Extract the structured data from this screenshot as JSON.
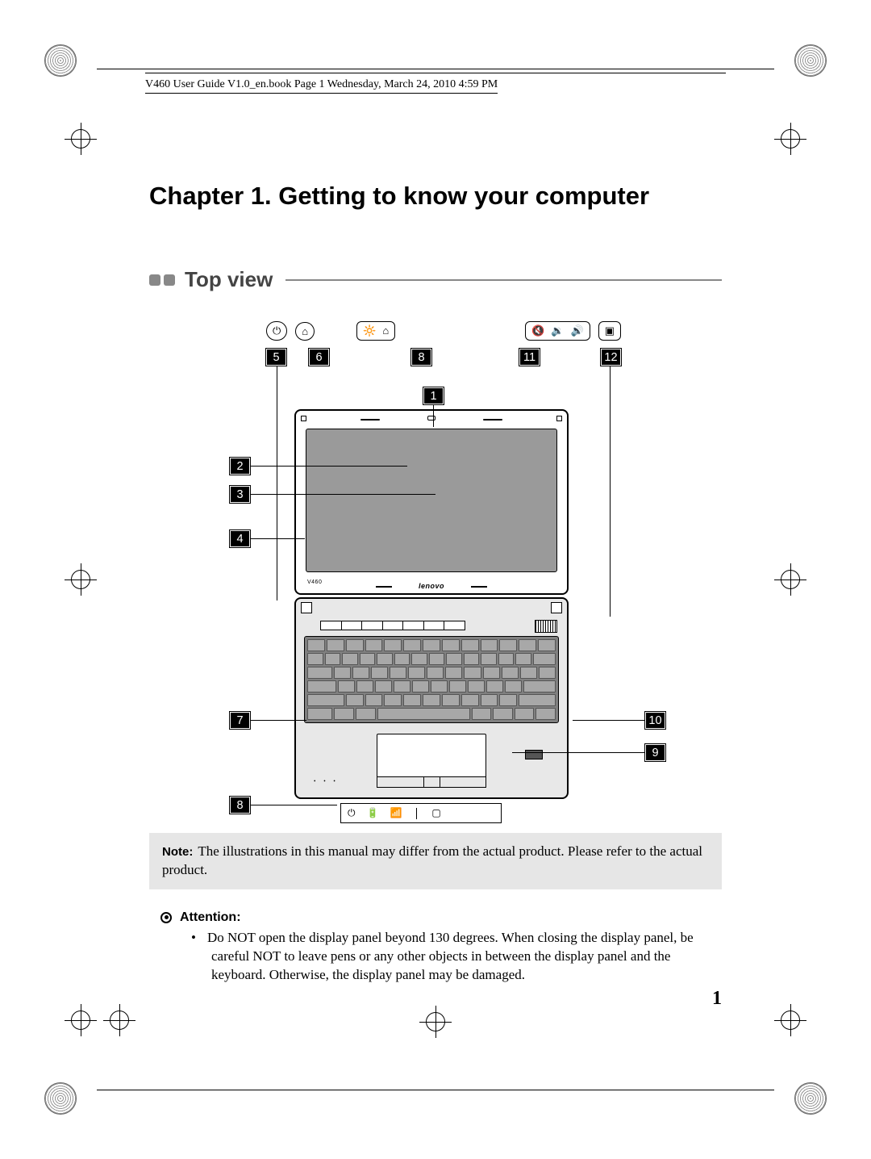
{
  "header": {
    "running_head": "V460 User Guide V1.0_en.book  Page 1  Wednesday, March 24, 2010  4:59 PM"
  },
  "chapter": {
    "title": "Chapter 1. Getting to know your computer"
  },
  "section": {
    "title": "Top view"
  },
  "diagram": {
    "top_callouts": [
      "5",
      "6",
      "8",
      "11",
      "12"
    ],
    "left_callouts": {
      "c1": "1",
      "c2": "2",
      "c3": "3",
      "c4": "4",
      "c7": "7",
      "c8": "8"
    },
    "right_callouts": {
      "c9": "9",
      "c10": "10"
    },
    "model": "V460",
    "brand": "lenovo"
  },
  "note": {
    "label": "Note:",
    "text": "The illustrations in this manual may differ from the actual product. Please refer to the actual product."
  },
  "attention": {
    "label": "Attention:",
    "items": [
      "Do NOT open the display panel beyond 130 degrees. When closing the display panel, be careful NOT to leave pens or any other objects in between the display panel and the keyboard. Otherwise, the display panel may be damaged."
    ]
  },
  "page_number": "1"
}
